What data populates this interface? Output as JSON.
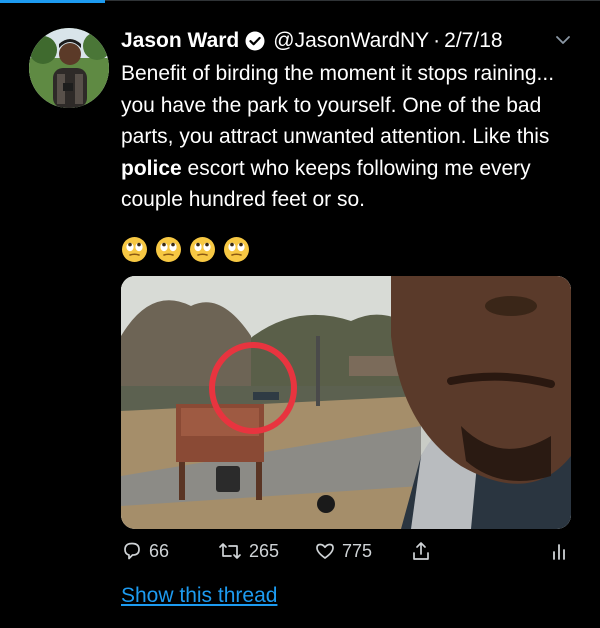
{
  "tweet": {
    "display_name": "Jason Ward",
    "handle": "@JasonWardNY",
    "separator": "·",
    "date": "2/7/18",
    "text_before_bold": "Benefit of birding the moment it stops raining... you have the park to yourself. One of the bad parts, you attract unwanted attention. Like this ",
    "text_bold": "police",
    "text_after_bold": " escort who keeps following me every couple hundred feet or so.",
    "emoji_icons": [
      "face-with-rolling-eyes-icon",
      "face-with-rolling-eyes-icon",
      "face-with-rolling-eyes-icon",
      "face-with-rolling-eyes-icon"
    ]
  },
  "actions": {
    "replies": "66",
    "retweets": "265",
    "likes": "775"
  },
  "footer": {
    "show_thread": "Show this thread"
  },
  "colors": {
    "background": "#000000",
    "text": "#ffffff",
    "link": "#1d9bf0",
    "circle_annotation": "#e8343f"
  }
}
